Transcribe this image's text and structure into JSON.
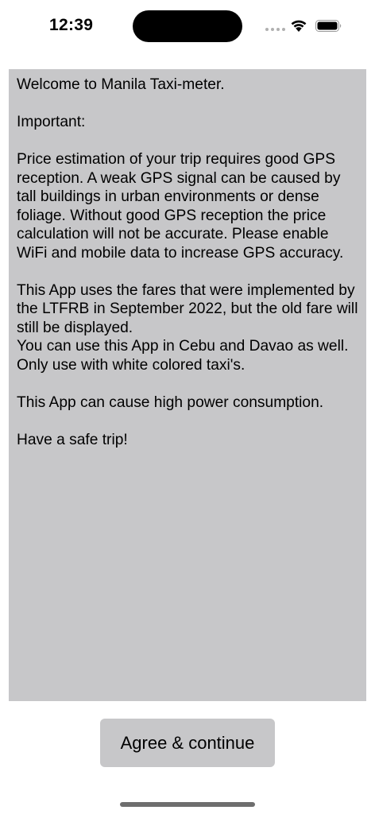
{
  "status_bar": {
    "time": "12:39",
    "icons": [
      "signal-icon",
      "wifi-icon",
      "battery-icon"
    ]
  },
  "intro": {
    "text": "Welcome to Manila Taxi-meter.\n\nImportant:\n\nPrice estimation of your trip requires good GPS reception. A weak GPS signal can be caused by tall buildings in urban environments or dense foliage. Without good GPS reception the price calculation will not be accurate. Please enable WiFi and mobile data to increase GPS accuracy.\n\nThis App uses the fares that were implemented by the LTFRB in September 2022, but the old fare will still be displayed.\nYou can use this App in Cebu and Davao as well. Only use with white colored taxi's.\n\nThis App can cause high power consumption.\n\nHave a safe trip!"
  },
  "footer": {
    "agree_label": "Agree & continue"
  },
  "colors": {
    "panel": "#c7c7c9",
    "button": "#c7c7c9",
    "background": "#ffffff",
    "text": "#000000"
  }
}
